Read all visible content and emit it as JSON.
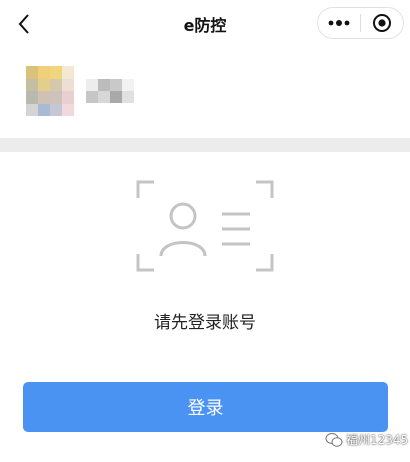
{
  "navbar": {
    "title": "e防控"
  },
  "profile": {
    "avatar_mosaic": [
      "#d9c27a",
      "#f1cf7a",
      "#f1d47e",
      "#f3e9d2",
      "#c6bea2",
      "#e3cf8a",
      "#d4c9ab",
      "#eedfd4",
      "#b9b9b0",
      "#cfc2b5",
      "#cfc2bd",
      "#e7cfd2",
      "#d4d4d4",
      "#a9bbd4",
      "#c3c7d6",
      "#f2d9dc"
    ],
    "name_mosaic": [
      "#ededed",
      "#bcbcbc",
      "#c9c9c9",
      "#f2f2f2",
      "#c6c6c6",
      "#d7d7d7",
      "#a9a9a9",
      "#e0e0e0"
    ]
  },
  "empty_state": {
    "message": "请先登录账号"
  },
  "login_button": {
    "label": "登录"
  },
  "watermark": {
    "text": "福州12345"
  },
  "colors": {
    "primary": "#4a93f2",
    "separator": "#ececec",
    "illustration": "#c4c4c4"
  },
  "icons": {
    "back": "chevron-left-icon",
    "more": "more-dots-icon",
    "close": "target-circle-icon",
    "illustration": "id-card-scan-icon",
    "watermark": "wechat-icon"
  }
}
